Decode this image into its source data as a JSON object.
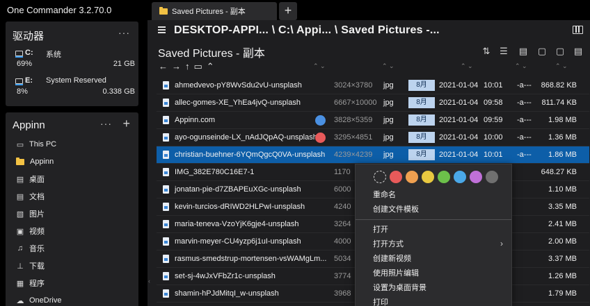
{
  "app": {
    "title": "One Commander 3.2.70.0"
  },
  "drives_card": {
    "title": "驱动器",
    "more": "···",
    "drives": [
      {
        "letter": "C:",
        "label": "系统",
        "percent": "69%",
        "free": "21 GB",
        "accent": "#3ca0ff"
      },
      {
        "letter": "E:",
        "label": "System Reserved",
        "percent": "8%",
        "free": "0.338 GB",
        "accent": "#3ca0ff"
      }
    ]
  },
  "nav_card": {
    "title": "Appinn",
    "more": "···",
    "add": "+",
    "items": [
      {
        "icon": "computer-icon",
        "glyph": "▭",
        "label": "This PC"
      },
      {
        "icon": "folder-icon",
        "glyph": "",
        "label": "Appinn"
      },
      {
        "icon": "desktop-icon",
        "glyph": "▤",
        "label": "桌面"
      },
      {
        "icon": "document-icon",
        "glyph": "▤",
        "label": "文档"
      },
      {
        "icon": "picture-icon",
        "glyph": "▧",
        "label": "图片"
      },
      {
        "icon": "video-icon",
        "glyph": "▣",
        "label": "视频"
      },
      {
        "icon": "music-icon",
        "glyph": "♫",
        "label": "音乐"
      },
      {
        "icon": "download-icon",
        "glyph": "⊥",
        "label": "下载"
      },
      {
        "icon": "program-icon",
        "glyph": "▦",
        "label": "程序"
      },
      {
        "icon": "cloud-icon",
        "glyph": "☁",
        "label": "OneDrive"
      }
    ]
  },
  "tabs": [
    {
      "label": "Saved Pictures - 副本"
    }
  ],
  "tab_add": "+",
  "header": {
    "path": "DESKTOP-APPI... \\ C:\\ Appi... \\ Saved Pictures -...",
    "folder_title": "Saved Pictures - 副本"
  },
  "toolbar_glyphs": {
    "sort": "⇅",
    "details": "☰",
    "copy_path": "▤",
    "new_file": "▢",
    "new_window": "▢",
    "paste": "▤"
  },
  "nav_buttons": {
    "back": "←",
    "forward": "→",
    "up": "↑",
    "folder": "▭",
    "chevron": "⌃",
    "dropdown": "⌄"
  },
  "column_chevrons": {
    "name": "⌃ ⌄",
    "dims": "⌃ ⌄",
    "ext": "⌃ ⌄",
    "date": "⌃ ⌄",
    "attr": "⌃ ⌄",
    "size": "⌃ ⌄"
  },
  "files": [
    {
      "name": "ahmedvevo-pY8WvSdu2vU-unsplash",
      "dims": "3024×3780",
      "ext": "jpg",
      "month": "8月",
      "date": "2021-01-04",
      "time": "10:01",
      "attr": "-a---",
      "size": "868.82 KB",
      "tag": ""
    },
    {
      "name": "allec-gomes-XE_YhEa4jvQ-unsplash",
      "dims": "6667×10000",
      "ext": "jpg",
      "month": "8月",
      "date": "2021-01-04",
      "time": "09:58",
      "attr": "-a---",
      "size": "811.74 KB",
      "tag": ""
    },
    {
      "name": "Appinn.com",
      "dims": "3828×5359",
      "ext": "jpg",
      "month": "8月",
      "date": "2021-01-04",
      "time": "09:59",
      "attr": "-a---",
      "size": "1.98 MB",
      "tag": "#4a90e2"
    },
    {
      "name": "ayo-ogunseinde-LX_nAdJQpAQ-unsplash",
      "dims": "3295×4851",
      "ext": "jpg",
      "month": "8月",
      "date": "2021-01-04",
      "time": "10:00",
      "attr": "-a---",
      "size": "1.36 MB",
      "tag": "#e85a5a"
    },
    {
      "name": "christian-buehner-6YQmQgcQ0VA-unsplash",
      "dims": "4239×4239",
      "ext": "jpg",
      "month": "8月",
      "date": "2021-01-04",
      "time": "10:01",
      "attr": "-a---",
      "size": "1.86 MB",
      "tag": "",
      "selected": true
    },
    {
      "name": "IMG_382E780C16E7-1",
      "dims": "1170",
      "ext": "",
      "month": "",
      "date": "",
      "time": "",
      "attr": "",
      "size": "648.27 KB",
      "tag": ""
    },
    {
      "name": "jonatan-pie-d7ZBAPEuXGc-unsplash",
      "dims": "6000",
      "ext": "",
      "month": "",
      "date": "",
      "time": "",
      "attr": "",
      "size": "1.10 MB",
      "tag": ""
    },
    {
      "name": "kevin-turcios-dRIWD2HLPwI-unsplash",
      "dims": "4240",
      "ext": "",
      "month": "",
      "date": "",
      "time": "",
      "attr": "",
      "size": "3.35 MB",
      "tag": ""
    },
    {
      "name": "maria-teneva-VzoYjK6gje4-unsplash",
      "dims": "3264",
      "ext": "",
      "month": "",
      "date": "",
      "time": "",
      "attr": "",
      "size": "2.41 MB",
      "tag": ""
    },
    {
      "name": "marvin-meyer-CU4yzp6j1uI-unsplash",
      "dims": "4000",
      "ext": "",
      "month": "",
      "date": "",
      "time": "",
      "attr": "",
      "size": "2.00 MB",
      "tag": ""
    },
    {
      "name": "rasmus-smedstrup-mortensen-vsWAMgLm...",
      "dims": "5034",
      "ext": "",
      "month": "",
      "date": "",
      "time": "",
      "attr": "",
      "size": "3.37 MB",
      "tag": ""
    },
    {
      "name": "set-sj-4wJxVFbZr1c-unsplash",
      "dims": "3774",
      "ext": "",
      "month": "",
      "date": "",
      "time": "",
      "attr": "",
      "size": "1.26 MB",
      "tag": ""
    },
    {
      "name": "shamin-hPJdMitqI_w-unsplash",
      "dims": "3968",
      "ext": "",
      "month": "",
      "date": "",
      "time": "",
      "attr": "",
      "size": "1.79 MB",
      "tag": ""
    }
  ],
  "context_menu": {
    "swatches": [
      "none",
      "#e85a5a",
      "#f0a050",
      "#e8c840",
      "#6cc04a",
      "#4aa8e8",
      "#c070d8",
      "#707070"
    ],
    "items": [
      {
        "label": "重命名"
      },
      {
        "label": "创建文件模板"
      },
      {
        "label": "打开",
        "sep_before": true
      },
      {
        "label": "打开方式",
        "submenu": "›"
      },
      {
        "label": "创建新视频"
      },
      {
        "label": "使用照片编辑"
      },
      {
        "label": "设置为桌面背景"
      },
      {
        "label": "打印"
      }
    ]
  }
}
